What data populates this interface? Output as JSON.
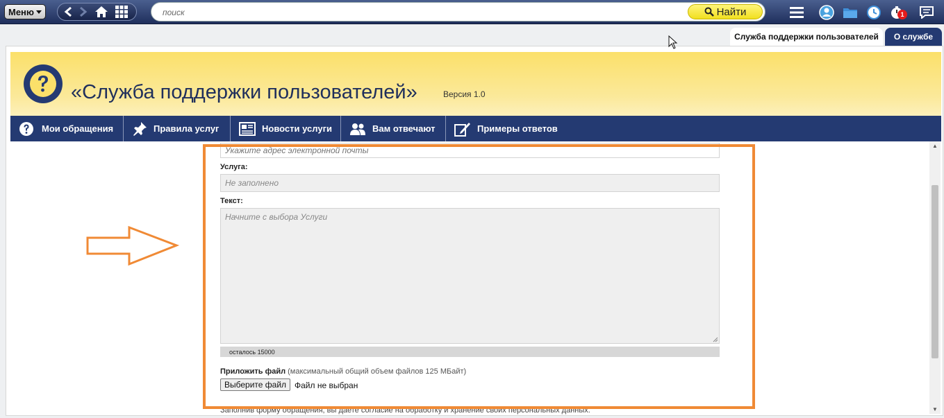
{
  "topbar": {
    "menu_label": "Меню",
    "search_placeholder": "поиск",
    "find_label": "Найти",
    "notification_count": "1"
  },
  "tabs": {
    "active": "Служба поддержки пользователей",
    "other": "О службе"
  },
  "header": {
    "title": "«Служба поддержки пользователей»",
    "version": "Версия 1.0"
  },
  "nav": {
    "items": [
      {
        "label": "Мои обращения",
        "icon": "question-icon"
      },
      {
        "label": "Правила услуг",
        "icon": "pin-icon"
      },
      {
        "label": "Новости услуги",
        "icon": "newspaper-icon"
      },
      {
        "label": "Вам отвечают",
        "icon": "people-icon"
      },
      {
        "label": "Примеры ответов",
        "icon": "edit-icon"
      }
    ]
  },
  "form": {
    "email_placeholder": "Укажите адрес электронной почты",
    "service_label": "Услуга:",
    "service_value": "Не заполнено",
    "text_label": "Текст:",
    "text_placeholder": "Начните с выбора Услуги",
    "counter": "осталось  15000",
    "attach_label": "Приложить файл",
    "attach_hint": " (максимальный общий объем файлов 125 МБайт)",
    "file_button": "Выберите файл",
    "file_status": "Файл не выбран",
    "consent_text": "Заполнив форму обращения, вы даете согласие на обработку и хранение своих персональных данных."
  },
  "colors": {
    "highlight": "#f08a35",
    "navy": "#243a72",
    "header_yellow": "#fbe06a"
  }
}
